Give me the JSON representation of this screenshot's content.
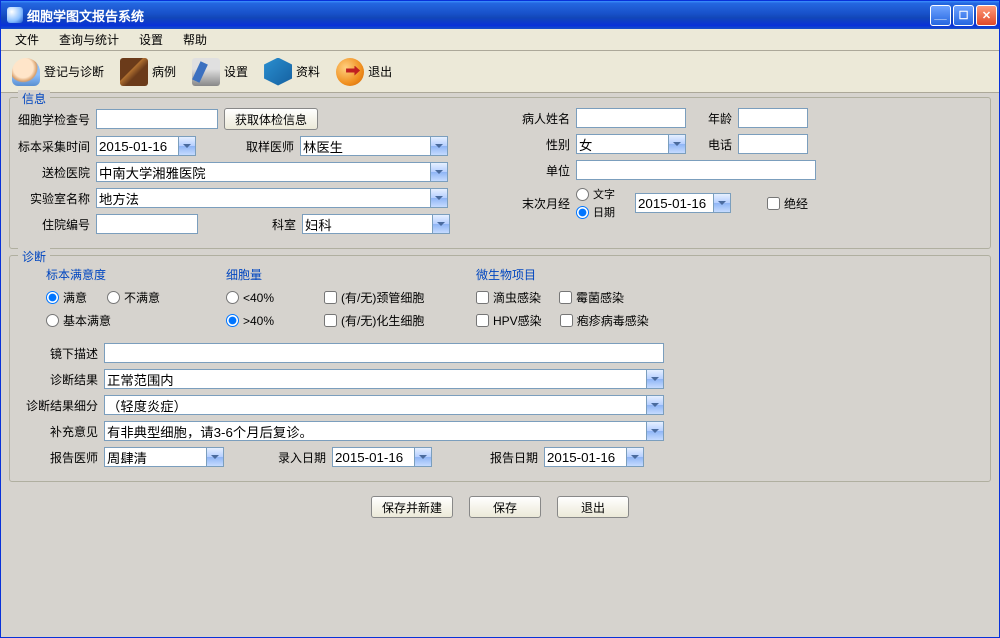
{
  "window": {
    "title": "细胞学图文报告系统"
  },
  "menu": {
    "file": "文件",
    "query": "查询与统计",
    "settings": "设置",
    "help": "帮助"
  },
  "toolbar": {
    "register": "登记与诊断",
    "case": "病例",
    "settings": "设置",
    "data": "资料",
    "exit": "退出"
  },
  "info": {
    "legend": "信息",
    "exam_no_label": "细胞学检查号",
    "exam_no": "",
    "fetch_btn": "获取体检信息",
    "collect_time_label": "标本采集时间",
    "collect_time": "2015-01-16",
    "sampling_doctor_label": "取样医师",
    "sampling_doctor": "林医生",
    "send_hospital_label": "送检医院",
    "send_hospital": "中南大学湘雅医院",
    "lab_name_label": "实验室名称",
    "lab_name": "地方法",
    "inpatient_no_label": "住院编号",
    "inpatient_no": "",
    "department_label": "科室",
    "department": "妇科",
    "patient_name_label": "病人姓名",
    "patient_name": "",
    "age_label": "年龄",
    "age": "",
    "sex_label": "性别",
    "sex": "女",
    "phone_label": "电话",
    "phone": "",
    "unit_label": "单位",
    "unit": "",
    "last_period_label": "末次月经",
    "lp_text": "文字",
    "lp_date": "日期",
    "lp_value": "2015-01-16",
    "menopause": "绝经"
  },
  "diag": {
    "legend": "诊断",
    "satisfaction_label": "标本满意度",
    "sat_ok": "满意",
    "sat_not": "不满意",
    "sat_basic": "基本满意",
    "cell_amount_label": "细胞量",
    "amount_lt40": "<40%",
    "amount_gt40": ">40%",
    "has_endocervical": "(有/无)颈管细胞",
    "has_hyperplastic": "(有/无)化生细胞",
    "microbe_label": "微生物项目",
    "trichomonad": "滴虫感染",
    "fungus": "霉菌感染",
    "hpv": "HPV感染",
    "herpes": "疱疹病毒感染",
    "micro_desc_label": "镜下描述",
    "micro_desc": "",
    "result_label": "诊断结果",
    "result": "正常范围内",
    "result_detail_label": "诊断结果细分",
    "result_detail": "（轻度炎症）",
    "extra_opinion_label": "补充意见",
    "extra_opinion": "有非典型细胞，请3-6个月后复诊。",
    "report_doctor_label": "报告医师",
    "report_doctor": "周肆清",
    "entry_date_label": "录入日期",
    "entry_date": "2015-01-16",
    "report_date_label": "报告日期",
    "report_date": "2015-01-16"
  },
  "buttons": {
    "save_new": "保存并新建",
    "save": "保存",
    "exit": "退出"
  }
}
